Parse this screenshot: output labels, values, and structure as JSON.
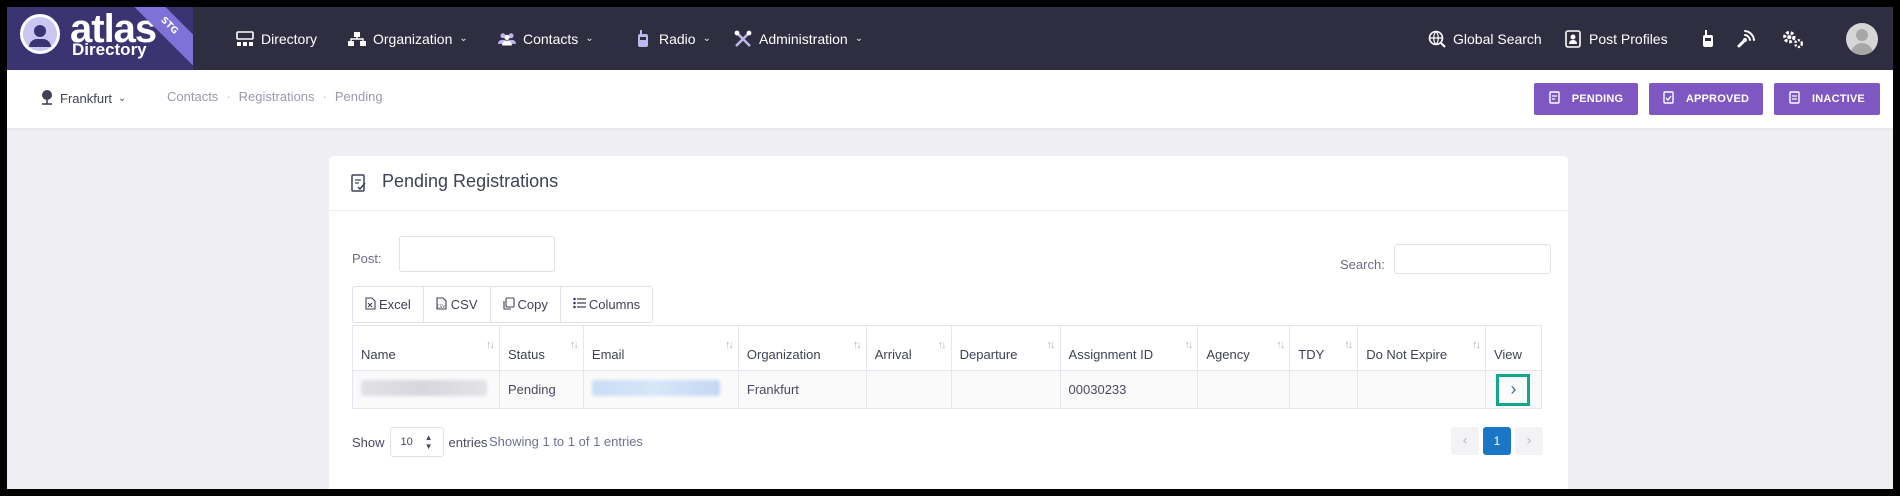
{
  "logo": {
    "word": "atlas",
    "sub": "Directory",
    "badge": "STG"
  },
  "nav": {
    "directory": "Directory",
    "organization": "Organization",
    "contacts": "Contacts",
    "radio": "Radio",
    "administration": "Administration",
    "global_search": "Global Search",
    "post_profiles": "Post Profiles"
  },
  "subheader": {
    "post": "Frankfurt",
    "breadcrumb": [
      "Contacts",
      "Registrations",
      "Pending"
    ],
    "buttons": {
      "pending": "PENDING",
      "approved": "APPROVED",
      "inactive": "INACTIVE"
    }
  },
  "card": {
    "title": "Pending Registrations",
    "post_label": "Post:",
    "post_value": "",
    "search_label": "Search:",
    "search_value": "",
    "export_buttons": {
      "excel": "Excel",
      "csv": "CSV",
      "copy": "Copy",
      "columns": "Columns"
    },
    "columns": [
      "Name",
      "Status",
      "Email",
      "Organization",
      "Arrival",
      "Departure",
      "Assignment ID",
      "Agency",
      "TDY",
      "Do Not Expire",
      "View"
    ],
    "rows": [
      {
        "status": "Pending",
        "organization": "Frankfurt",
        "arrival": "",
        "departure": "",
        "assignment_id": "00030233",
        "agency": "",
        "tdy": "",
        "do_not_expire": ""
      }
    ],
    "show_label": "Show",
    "page_length": "10",
    "entries_label": "entries",
    "info": "Showing 1 to 1 of 1 entries",
    "current_page": "1"
  },
  "colors": {
    "topbar": "#2f2d40",
    "accent": "#7e57c2",
    "page_active": "#1b76c6",
    "highlight": "#0fa88a"
  }
}
